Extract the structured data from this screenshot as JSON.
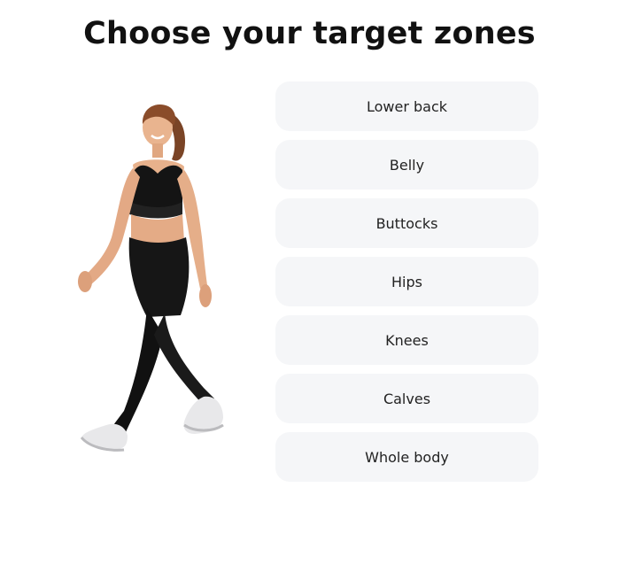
{
  "page": {
    "title": "Choose your target zones"
  },
  "illustration": {
    "icon": "woman-walking-activewear-illustration"
  },
  "zones": [
    {
      "id": "lower-back",
      "label": "Lower back"
    },
    {
      "id": "belly",
      "label": "Belly"
    },
    {
      "id": "buttocks",
      "label": "Buttocks"
    },
    {
      "id": "hips",
      "label": "Hips"
    },
    {
      "id": "knees",
      "label": "Knees"
    },
    {
      "id": "calves",
      "label": "Calves"
    },
    {
      "id": "whole-body",
      "label": "Whole body"
    }
  ],
  "colors": {
    "option_background": "#f5f6f8",
    "title": "#111111",
    "option_text": "#222222"
  }
}
